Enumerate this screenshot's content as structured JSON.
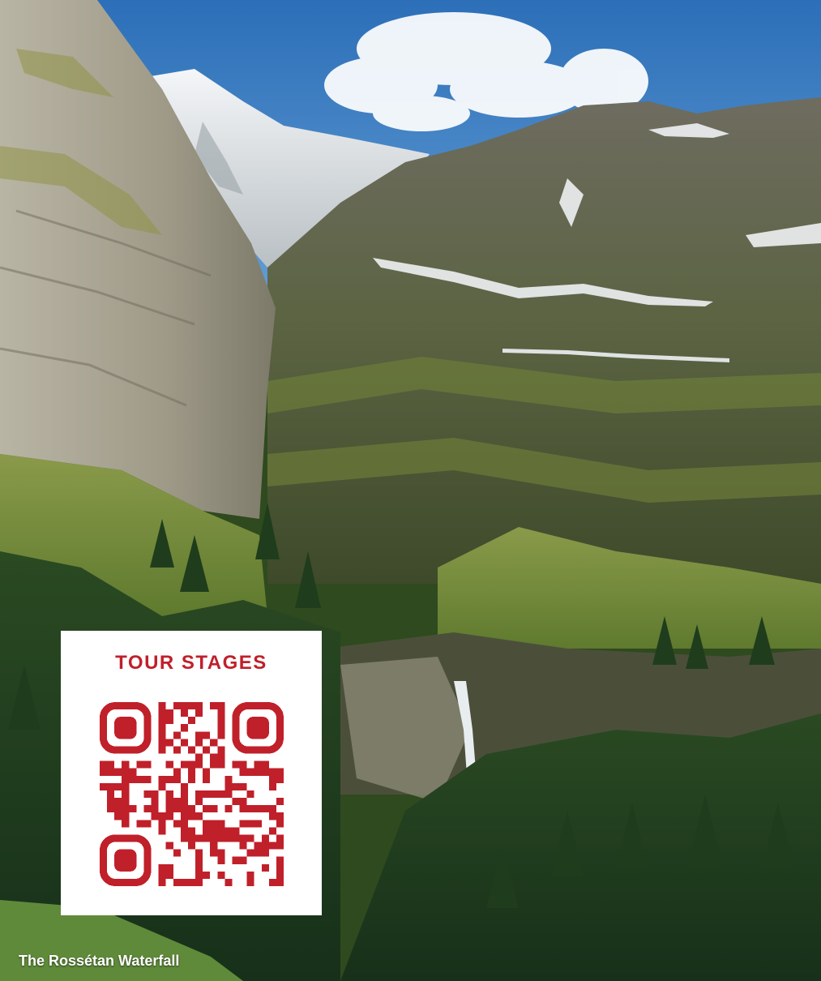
{
  "photo": {
    "subject": "alpine valley with waterfall",
    "caption": "The Rossétan Waterfall"
  },
  "qr_card": {
    "title": "TOUR STAGES",
    "accent_color": "#c0202a",
    "background_color": "#ffffff"
  }
}
